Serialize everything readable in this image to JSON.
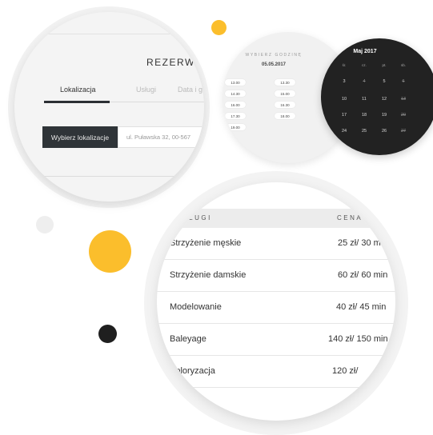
{
  "booking": {
    "title": "REZERWAC",
    "tabs": [
      {
        "label": "Lokalizacja",
        "active": true
      },
      {
        "label": "Usługi",
        "active": false
      },
      {
        "label": "Data i g",
        "active": false
      }
    ],
    "location_button": "Wybierz lokalizacje",
    "address": "ul. Puławska 32, 00-567"
  },
  "hours": {
    "title": "WYBIERZ GODZINĘ",
    "date": "05.05.2017",
    "columns": [
      [
        "13.00",
        "14.30",
        "16.00",
        "17.30",
        "19.00"
      ],
      [
        "13.30",
        "15.00",
        "16.30",
        "18.00"
      ],
      [
        "14.00",
        "15.30",
        "17.00",
        "18.30"
      ]
    ]
  },
  "calendar": {
    "month": "Maj 2017",
    "weekdays": [
      "śr.",
      "cz.",
      "pt.",
      "sb."
    ],
    "rows": [
      [
        "3",
        "4",
        "5",
        "6"
      ],
      [
        "10",
        "11",
        "12",
        "13"
      ],
      [
        "17",
        "18",
        "19",
        "20"
      ],
      [
        "24",
        "25",
        "26",
        "27"
      ],
      [
        "31",
        "",
        "",
        ""
      ]
    ],
    "disabled": [
      "4",
      "6",
      "13",
      "20",
      "27"
    ]
  },
  "services": {
    "headers": {
      "name": "USŁUGI",
      "price": "CENA"
    },
    "rows": [
      {
        "name": "Strzyżenie męskie",
        "price": "25 zł/ 30 min"
      },
      {
        "name": "Strzyżenie damskie",
        "price": "60 zł/ 60 min"
      },
      {
        "name": "Modelowanie",
        "price": "40 zł/ 45 min"
      },
      {
        "name": "Baleyage",
        "price": "140 zł/ 150 min"
      },
      {
        "name": "Koloryzacja",
        "price": "120 zł/"
      }
    ]
  },
  "colors": {
    "accent_yellow": "#FBBE2C",
    "dark": "#222222",
    "light_gray": "#EEEEEE"
  }
}
